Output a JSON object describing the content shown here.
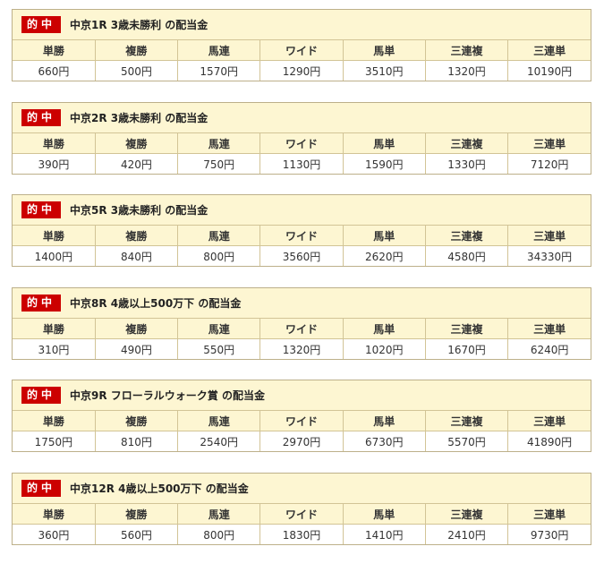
{
  "hit_label": "的中",
  "bet_types": [
    "単勝",
    "複勝",
    "馬連",
    "ワイド",
    "馬単",
    "三連複",
    "三連単"
  ],
  "races": [
    {
      "title": "中京1R 3歳未勝利 の配当金",
      "payouts": [
        "660円",
        "500円",
        "1570円",
        "1290円",
        "3510円",
        "1320円",
        "10190円"
      ]
    },
    {
      "title": "中京2R 3歳未勝利 の配当金",
      "payouts": [
        "390円",
        "420円",
        "750円",
        "1130円",
        "1590円",
        "1330円",
        "7120円"
      ]
    },
    {
      "title": "中京5R 3歳未勝利 の配当金",
      "payouts": [
        "1400円",
        "840円",
        "800円",
        "3560円",
        "2620円",
        "4580円",
        "34330円"
      ]
    },
    {
      "title": "中京8R 4歳以上500万下 の配当金",
      "payouts": [
        "310円",
        "490円",
        "550円",
        "1320円",
        "1020円",
        "1670円",
        "6240円"
      ]
    },
    {
      "title": "中京9R フローラルウォーク賞 の配当金",
      "payouts": [
        "1750円",
        "810円",
        "2540円",
        "2970円",
        "6730円",
        "5570円",
        "41890円"
      ]
    },
    {
      "title": "中京12R 4歳以上500万下 の配当金",
      "payouts": [
        "360円",
        "560円",
        "800円",
        "1830円",
        "1410円",
        "2410円",
        "9730円"
      ]
    }
  ]
}
